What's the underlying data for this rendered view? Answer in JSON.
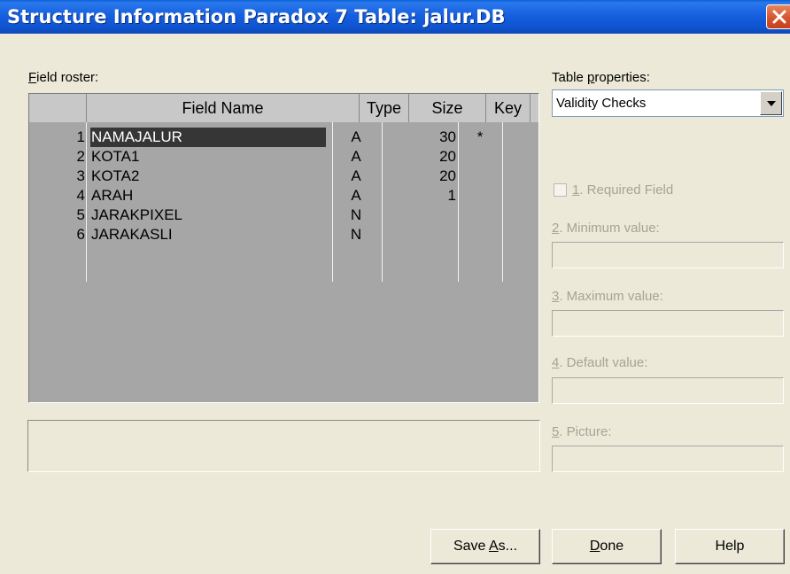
{
  "window": {
    "title": "Structure Information Paradox 7 Table: jalur.DB"
  },
  "roster": {
    "label_prefix": "",
    "label_accel": "F",
    "label_rest": "ield roster:",
    "columns": [
      "",
      "Field Name",
      "Type",
      "Size",
      "Key"
    ],
    "rows": [
      {
        "num": "1",
        "name": "NAMAJALUR",
        "type": "A",
        "size": "30",
        "key": "*"
      },
      {
        "num": "2",
        "name": "KOTA1",
        "type": "A",
        "size": "20",
        "key": ""
      },
      {
        "num": "3",
        "name": "KOTA2",
        "type": "A",
        "size": "20",
        "key": ""
      },
      {
        "num": "4",
        "name": "ARAH",
        "type": "A",
        "size": "1",
        "key": ""
      },
      {
        "num": "5",
        "name": "JARAKPIXEL",
        "type": "N",
        "size": "",
        "key": ""
      },
      {
        "num": "6",
        "name": "JARAKASLI",
        "type": "N",
        "size": "",
        "key": ""
      }
    ],
    "description": ""
  },
  "properties": {
    "label_prefix": "Table ",
    "label_accel": "p",
    "label_rest": "roperties:",
    "selected": "Validity Checks",
    "required": {
      "accel": "1",
      "rest": ". Required Field",
      "checked": false
    },
    "minimum": {
      "accel": "2",
      "rest": ". Minimum value:",
      "value": ""
    },
    "maximum": {
      "accel": "3",
      "rest": ". Maximum value:",
      "value": ""
    },
    "default": {
      "accel": "4",
      "rest": ". Default value:",
      "value": ""
    },
    "picture": {
      "accel": "5",
      "rest": ". Picture:",
      "value": ""
    }
  },
  "buttons": {
    "save_as_prefix": "Save ",
    "save_as_accel": "A",
    "save_as_rest": "s...",
    "done_accel": "D",
    "done_rest": "one",
    "help": "Help"
  },
  "colors": {
    "titlebar": "#0f54d0",
    "grid_background": "#a6a6a6",
    "selection": "#363636",
    "dialog": "#ece9d8",
    "disabled_text": "#a6a398"
  },
  "icons": {
    "close": "close-icon",
    "dropdown": "chevron-down-icon"
  }
}
